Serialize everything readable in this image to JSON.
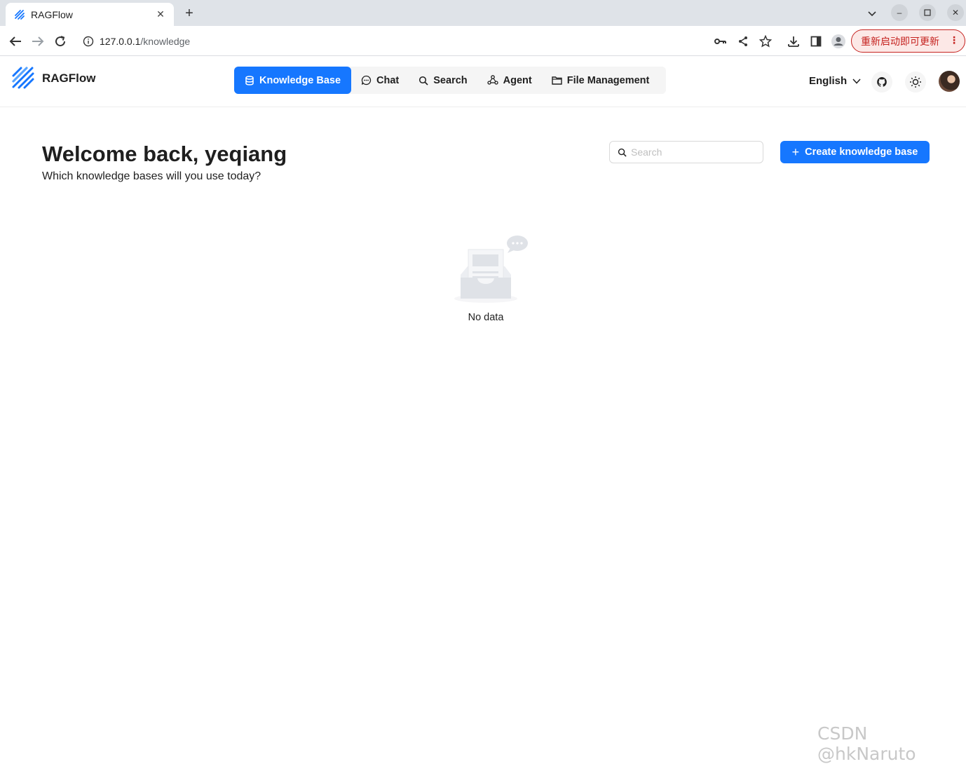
{
  "browser": {
    "tab_title": "RAGFlow",
    "url_host": "127.0.0.1",
    "url_path": "/knowledge",
    "update_button": "重新启动即可更新"
  },
  "header": {
    "brand": "RAGFlow",
    "nav": [
      {
        "label": "Knowledge Base",
        "icon": "database-icon",
        "active": true
      },
      {
        "label": "Chat",
        "icon": "chat-bubble-icon",
        "active": false
      },
      {
        "label": "Search",
        "icon": "search-icon",
        "active": false
      },
      {
        "label": "Agent",
        "icon": "agent-graph-icon",
        "active": false
      },
      {
        "label": "File Management",
        "icon": "folder-icon",
        "active": false
      }
    ],
    "language": "English"
  },
  "main": {
    "welcome": "Welcome back, yeqiang",
    "subtitle": "Which knowledge bases will you use today?",
    "search_placeholder": "Search",
    "create_button": "Create knowledge base",
    "empty_text": "No data"
  },
  "watermark": "CSDN @hkNaruto",
  "colors": {
    "primary": "#1677ff",
    "update_red": "#c5221f"
  }
}
